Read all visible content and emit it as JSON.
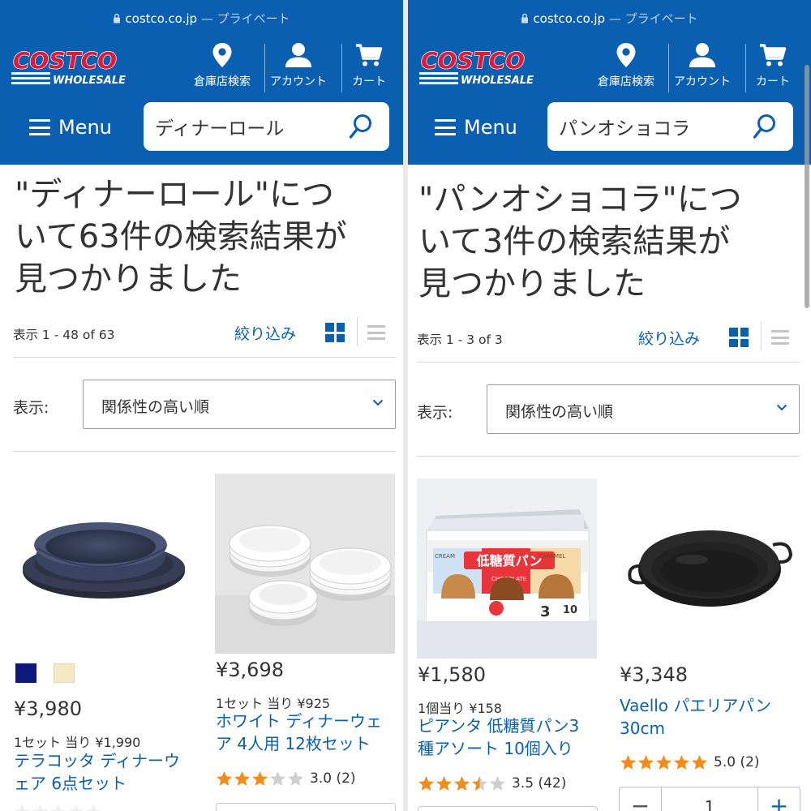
{
  "colors": {
    "header_blue": "#0a5fb0",
    "link_blue": "#0b5fb0",
    "logo_red": "#e31837",
    "star_orange": "#f28c1a"
  },
  "panels": [
    {
      "url": "costco.co.jp",
      "url_suffix": " — プライベート",
      "logo_text": "COSTCO",
      "logo_sub": "WHOLESALE",
      "nav": {
        "warehouse": "倉庫店検索",
        "account": "アカウント",
        "cart": "カート"
      },
      "menu_label": "Menu",
      "search_query": "ディナーロール",
      "result_title_lines": [
        "\"ディナーロール\"につ",
        "いて63件の検索結果が",
        "見つかりました"
      ],
      "result_count": "表示 1 - 48 of 63",
      "refine_label": "絞り込み",
      "sort_label": "表示:",
      "sort_value": "関係性の高い順",
      "products": [
        {
          "price": "¥3,980",
          "unit_price": "1セット 当り ¥1,990",
          "name": "テラコッタ ディナーウェア 6点セット",
          "name_lines": [
            "テラコッタ ディナーウ",
            "ェア 6点セット"
          ],
          "swatches": [
            "#0d1a7a",
            "#f5e9c4"
          ],
          "rating": null
        },
        {
          "price": "¥3,698",
          "unit_price": "1セット 当り ¥925",
          "name": "ホワイト ディナーウェア 4人用 12枚セット",
          "name_lines": [
            "ホワイト ディナーウェ",
            "ア 4人用 12枚セット"
          ],
          "rating": 3.0,
          "rating_text": "3.0 (2)"
        }
      ]
    },
    {
      "url": "costco.co.jp",
      "url_suffix": " — プライベート",
      "logo_text": "COSTCO",
      "logo_sub": "WHOLESALE",
      "nav": {
        "warehouse": "倉庫店検索",
        "account": "アカウント",
        "cart": "カート"
      },
      "menu_label": "Menu",
      "search_query": "パンオショコラ",
      "result_title_lines": [
        "\"パンオショコラ\"につ",
        "いて3件の検索結果が",
        "見つかりました"
      ],
      "result_count": "表示 1 - 3 of 3",
      "refine_label": "絞り込み",
      "sort_label": "表示:",
      "sort_value": "関係性の高い順",
      "products": [
        {
          "price": "¥1,580",
          "unit_price": "1個当り ¥158",
          "name": "ピアンタ 低糖質パン3種アソート 10個入り",
          "name_lines": [
            "ピアンタ 低糖質パン3",
            "種アソート 10個入り"
          ],
          "rating": 3.5,
          "rating_text": "3.5 (42)",
          "box_label": "低糖質パン",
          "box_flavors": [
            "CREAM",
            "CHOCOLATE",
            "CARAMEL"
          ],
          "box_count": "3",
          "box_pieces": "10"
        },
        {
          "price": "¥3,348",
          "unit_price": "",
          "name": "Vaello パエリアパン 30cm",
          "name_lines": [
            "Vaello パエリアパン",
            "30cm"
          ],
          "rating": 5.0,
          "rating_text": "5.0 (2)",
          "quantity": "1",
          "qty_minus": "−",
          "qty_plus": "+"
        }
      ]
    }
  ]
}
